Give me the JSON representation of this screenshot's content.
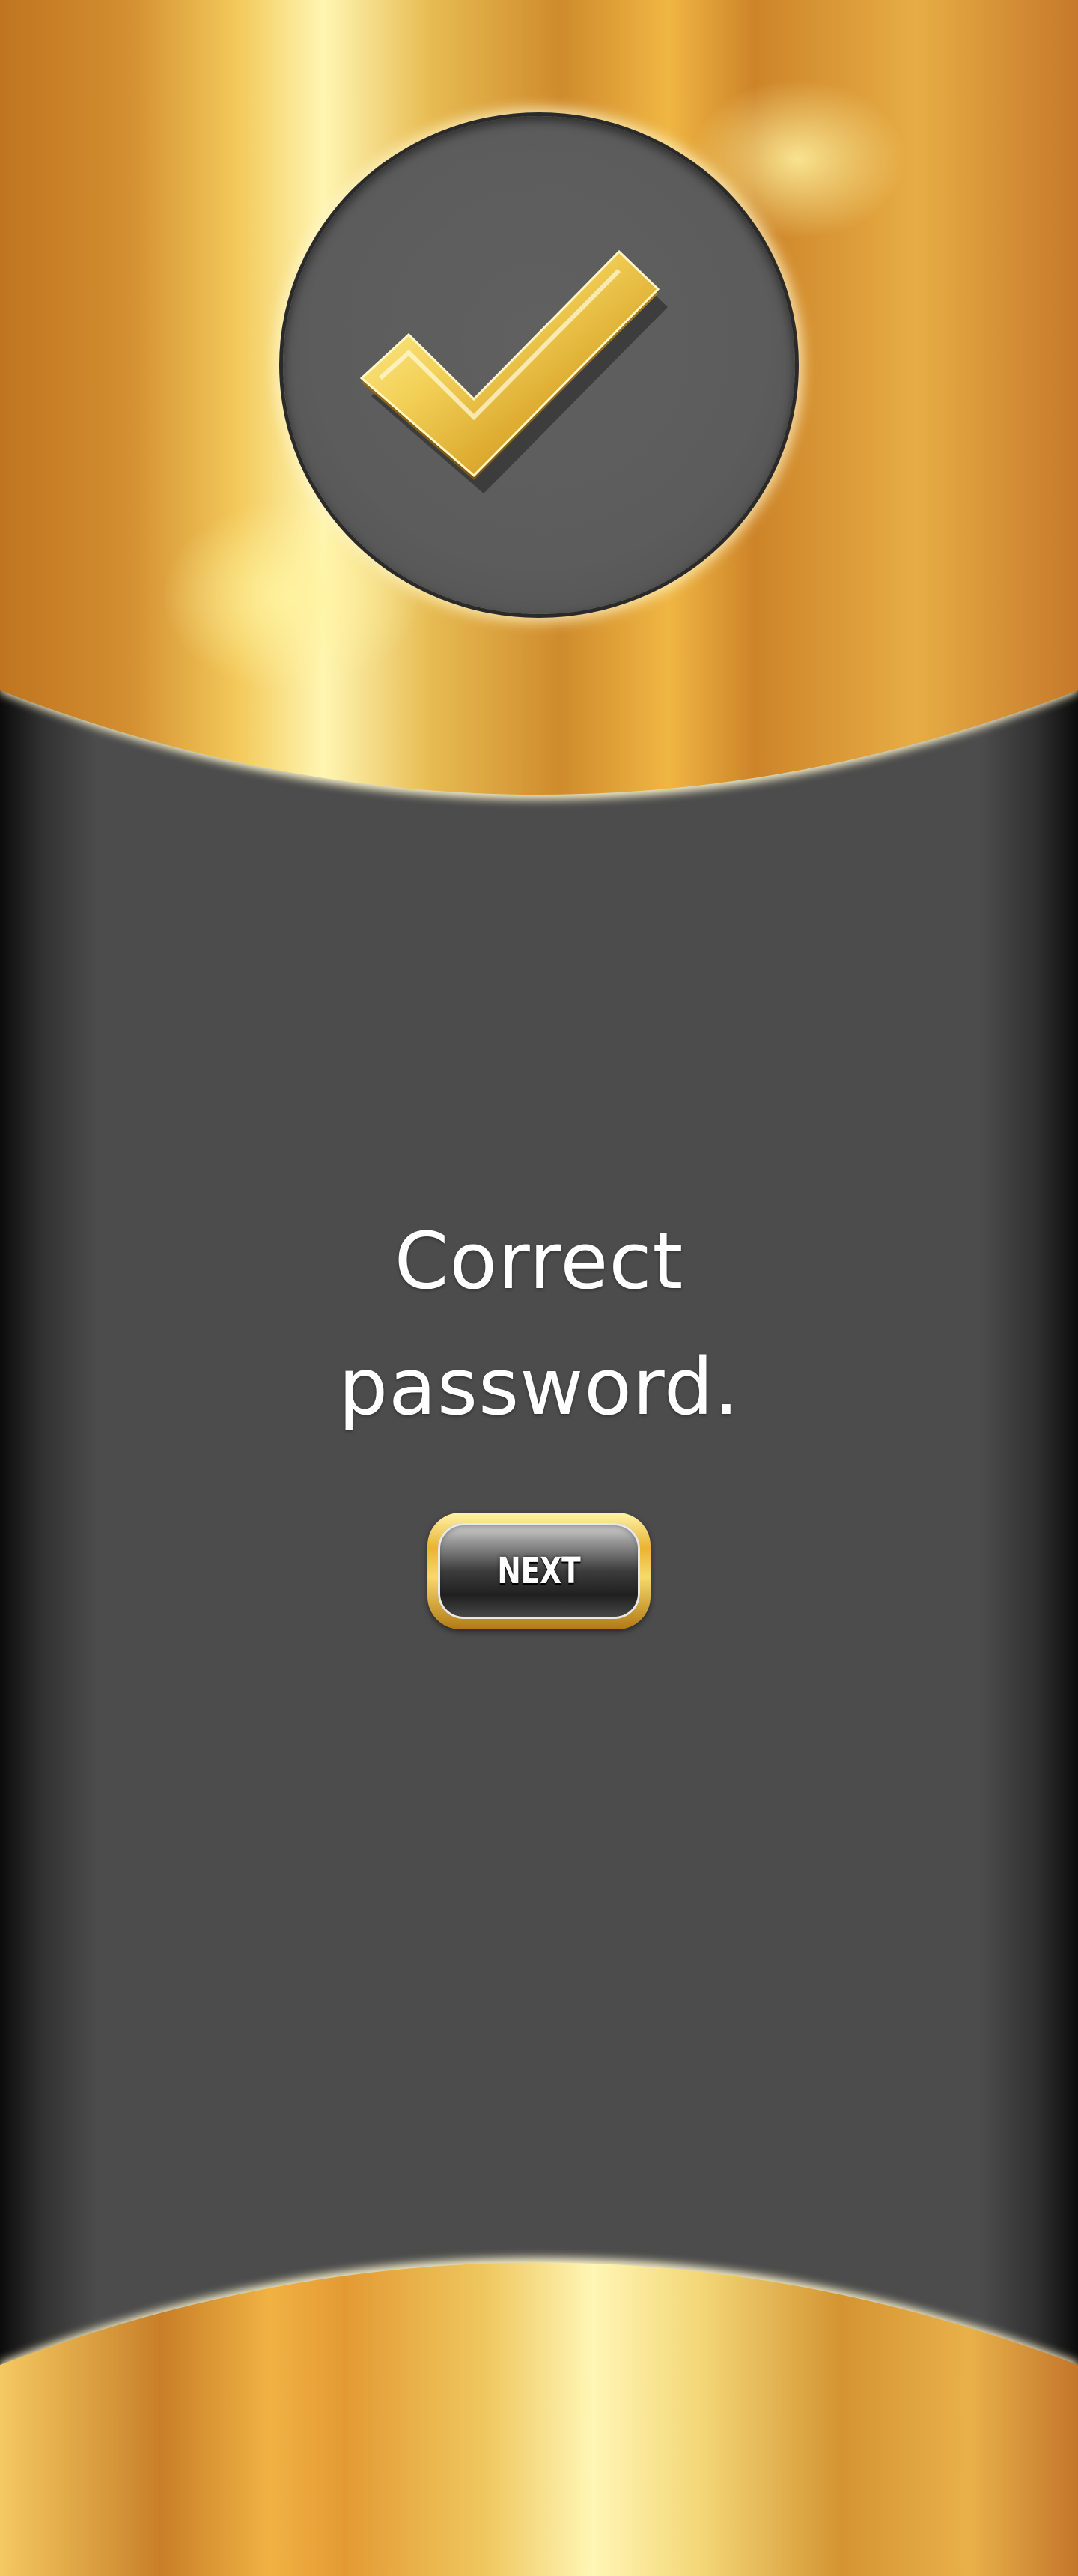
{
  "screen": {
    "message_line1": "Correct",
    "message_line2": "password.",
    "next_label": "NEXT"
  },
  "colors": {
    "gold_dark": "#c47a22",
    "gold_light": "#fff5b0",
    "gold_mid": "#e9a93a",
    "panel": "#4c4c4c",
    "badge": "#5e5e5e",
    "text": "#ffffff"
  },
  "icons": {
    "badge_icon": "checkmark-icon"
  }
}
